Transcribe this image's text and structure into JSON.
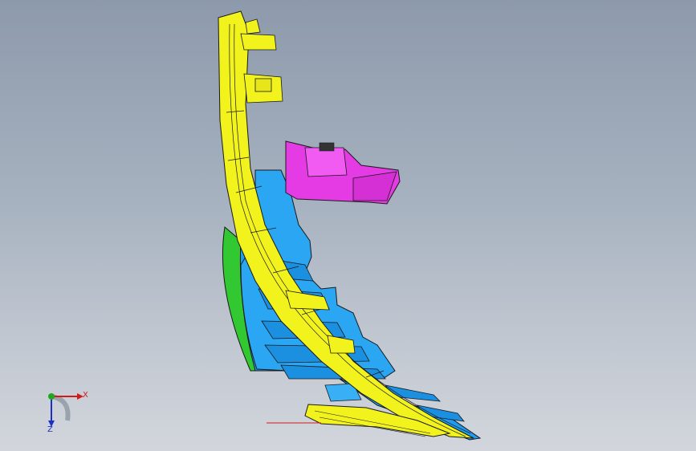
{
  "viewport": {
    "background_top": "#8d9aab",
    "background_bottom": "#d2d6dc"
  },
  "model": {
    "colors": {
      "yellow_part": "#f2f21c",
      "blue_part": "#1e9cf0",
      "magenta_part": "#e43be4",
      "green_part": "#32c832",
      "edge": "#1a1a1a"
    }
  },
  "triad": {
    "x_label": "X",
    "z_label": "Z",
    "x_color": "#d01b1b",
    "y_color": "#1ea81e",
    "z_color": "#1c2fc8"
  }
}
